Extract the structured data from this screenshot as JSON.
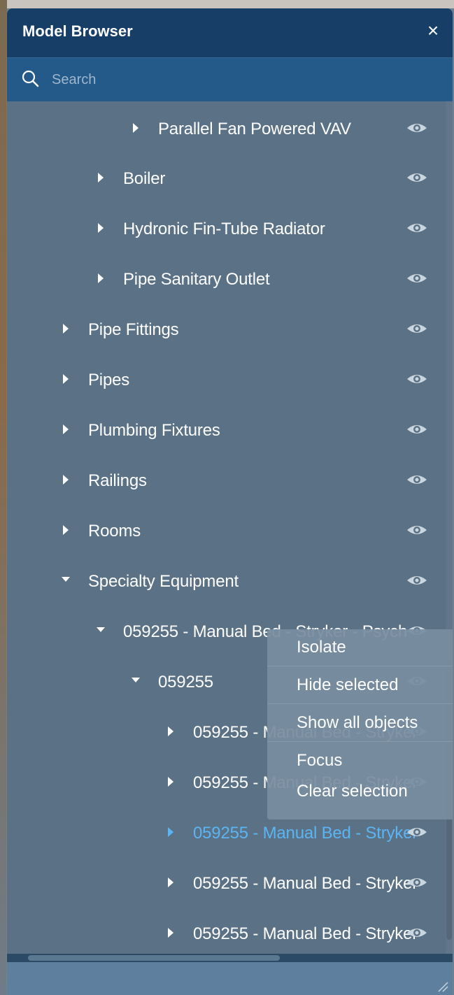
{
  "panel": {
    "title": "Model Browser",
    "close_symbol": "×"
  },
  "search": {
    "placeholder": "Search",
    "value": ""
  },
  "tree": {
    "rows": [
      {
        "label": "Parallel Fan Powered VAV",
        "expanded": false,
        "level": 3,
        "icon": "eye-icon"
      },
      {
        "label": "Boiler",
        "expanded": false,
        "level": 2,
        "icon": "eye-icon"
      },
      {
        "label": "Hydronic Fin-Tube Radiator",
        "expanded": false,
        "level": 2,
        "icon": "eye-icon"
      },
      {
        "label": "Pipe Sanitary Outlet",
        "expanded": false,
        "level": 2,
        "icon": "eye-icon"
      },
      {
        "label": "Pipe Fittings",
        "expanded": false,
        "level": 1,
        "icon": "eye-icon"
      },
      {
        "label": "Pipes",
        "expanded": false,
        "level": 1,
        "icon": "eye-icon"
      },
      {
        "label": "Plumbing Fixtures",
        "expanded": false,
        "level": 1,
        "icon": "eye-icon"
      },
      {
        "label": "Railings",
        "expanded": false,
        "level": 1,
        "icon": "eye-icon"
      },
      {
        "label": "Rooms",
        "expanded": false,
        "level": 1,
        "icon": "eye-icon"
      },
      {
        "label": "Specialty Equipment",
        "expanded": true,
        "level": 1,
        "icon": "eye-icon"
      },
      {
        "label": "059255 - Manual Bed - Stryker - Psych",
        "expanded": true,
        "level": 2,
        "icon": "eye-icon"
      },
      {
        "label": "059255",
        "expanded": true,
        "level": 3,
        "icon": "eye-icon"
      },
      {
        "label": "059255 - Manual Bed - Stryker",
        "expanded": false,
        "level": 4,
        "icon": "eye-icon"
      },
      {
        "label": "059255 - Manual Bed - Stryker",
        "expanded": false,
        "level": 4,
        "icon": "eye-icon"
      },
      {
        "label": "059255 - Manual Bed - Stryker",
        "expanded": false,
        "level": 4,
        "selected": true,
        "icon": "eye-icon"
      },
      {
        "label": "059255 - Manual Bed - Stryker",
        "expanded": false,
        "level": 4,
        "icon": "eye-icon"
      },
      {
        "label": "059255 - Manual Bed - Stryker",
        "expanded": false,
        "level": 4,
        "icon": "eye-icon"
      }
    ]
  },
  "context_menu": {
    "items": [
      {
        "label": "Isolate"
      },
      {
        "label": "Hide selected"
      },
      {
        "label": "Show all objects"
      },
      {
        "label": "Focus"
      },
      {
        "label": "Clear selection"
      }
    ]
  },
  "colors": {
    "header": "#173e66",
    "search_bar": "#235a8a",
    "panel": "#5b7186",
    "selected_text": "#5bb5f2",
    "text": "#ffffff"
  }
}
